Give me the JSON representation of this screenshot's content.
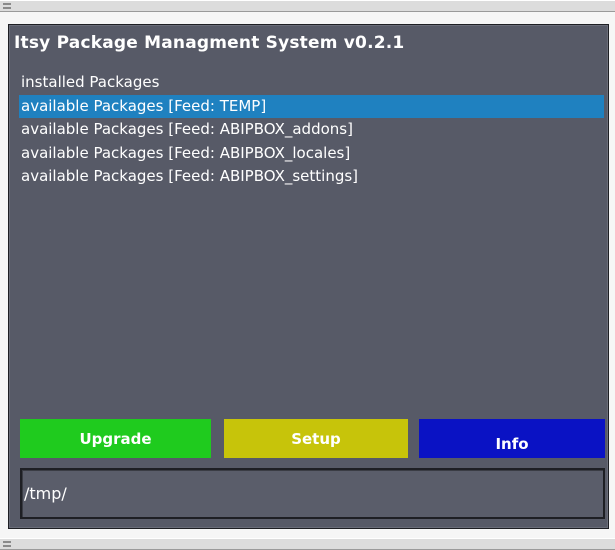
{
  "window": {
    "title": "Itsy Package Managment System v0.2.1"
  },
  "menu": {
    "selected_index": 1,
    "items": [
      {
        "label": "installed Packages"
      },
      {
        "label": "available Packages [Feed: TEMP]"
      },
      {
        "label": "available Packages [Feed: ABIPBOX_addons]"
      },
      {
        "label": "available Packages [Feed: ABIPBOX_locales]"
      },
      {
        "label": "available Packages [Feed: ABIPBOX_settings]"
      }
    ]
  },
  "buttons": {
    "upgrade_label": "Upgrade",
    "setup_label": "Setup",
    "info_label": "Info"
  },
  "path": {
    "value": "/tmp/"
  },
  "colors": {
    "window_bg": "#575a67",
    "selection": "#1f81c0",
    "upgrade": "#1fcb1e",
    "setup": "#c7c40a",
    "info": "#0a12c4"
  }
}
